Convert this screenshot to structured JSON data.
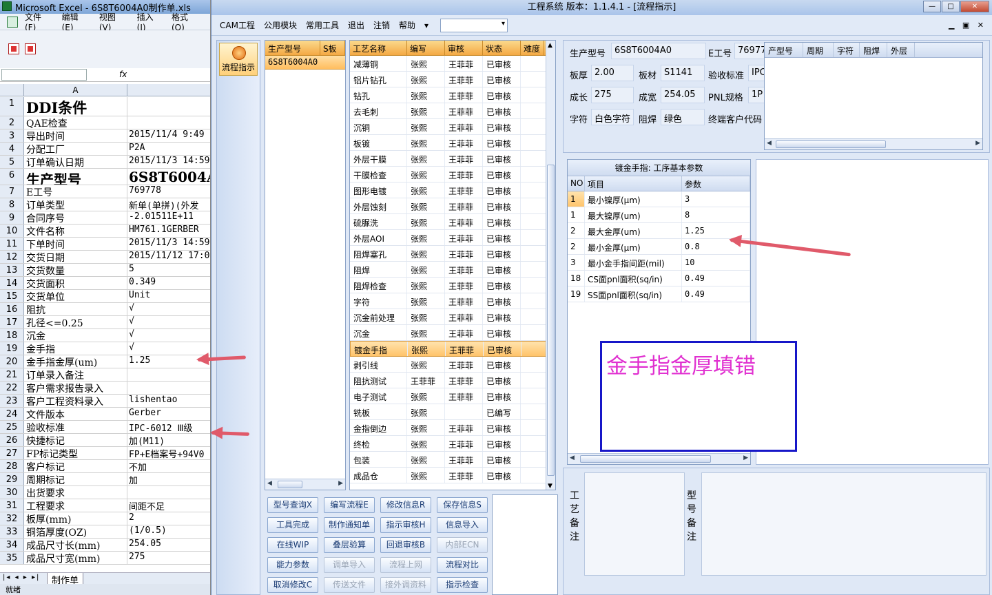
{
  "excel": {
    "title": "Microsoft Excel - 6S8T6004A0制作单.xls",
    "menu": [
      "文件(F)",
      "编辑(E)",
      "视图(V)",
      "插入(I)",
      "格式(O)"
    ],
    "fx": "fx",
    "col_header": "A",
    "rows": [
      {
        "n": "1",
        "a": "DDI条件",
        "b": "",
        "style": "big"
      },
      {
        "n": "2",
        "a": "QAE检查",
        "b": ""
      },
      {
        "n": "3",
        "a": "导出时间",
        "b": "2015/11/4 9:49"
      },
      {
        "n": "4",
        "a": "分配工厂",
        "b": "P2A"
      },
      {
        "n": "5",
        "a": "订单确认日期",
        "b": "2015/11/3 14:59"
      },
      {
        "n": "6",
        "a": "生产型号",
        "b": "6S8T6004A0",
        "style": "mid"
      },
      {
        "n": "7",
        "a": "E工号",
        "b": "769778"
      },
      {
        "n": "8",
        "a": "订单类型",
        "b": "新单(单拼)(外发"
      },
      {
        "n": "9",
        "a": "合同序号",
        "b": "-2.01511E+11"
      },
      {
        "n": "10",
        "a": "文件名称",
        "b": "HM761.1GERBER"
      },
      {
        "n": "11",
        "a": "下单时间",
        "b": "2015/11/3 14:59"
      },
      {
        "n": "12",
        "a": "交货日期",
        "b": "2015/11/12 17:0"
      },
      {
        "n": "13",
        "a": "交货数量",
        "b": "5"
      },
      {
        "n": "14",
        "a": "交货面积",
        "b": "0.349"
      },
      {
        "n": "15",
        "a": "交货单位",
        "b": "Unit"
      },
      {
        "n": "16",
        "a": "阻抗",
        "b": "√"
      },
      {
        "n": "17",
        "a": "孔径<=0.25",
        "b": "√"
      },
      {
        "n": "18",
        "a": "沉金",
        "b": "√"
      },
      {
        "n": "19",
        "a": "金手指",
        "b": "√"
      },
      {
        "n": "20",
        "a": "金手指金厚(um)",
        "b": "1.25"
      },
      {
        "n": "21",
        "a": "订单录入备注",
        "b": ""
      },
      {
        "n": "22",
        "a": "客户需求报告录入",
        "b": ""
      },
      {
        "n": "23",
        "a": "客户工程资料录入",
        "b": "lishentao"
      },
      {
        "n": "24",
        "a": "文件版本",
        "b": "Gerber"
      },
      {
        "n": "25",
        "a": "验收标准",
        "b": "IPC-6012 Ⅲ级"
      },
      {
        "n": "26",
        "a": "快捷标记",
        "b": "加(M11)"
      },
      {
        "n": "27",
        "a": "FP标记类型",
        "b": "FP+E档案号+94V0"
      },
      {
        "n": "28",
        "a": "客户标记",
        "b": "不加"
      },
      {
        "n": "29",
        "a": "周期标记",
        "b": "加"
      },
      {
        "n": "30",
        "a": "出货要求",
        "b": ""
      },
      {
        "n": "31",
        "a": "工程要求",
        "b": "间距不足"
      },
      {
        "n": "32",
        "a": "板厚(mm)",
        "b": "2"
      },
      {
        "n": "33",
        "a": "铜箔厚度(OZ)",
        "b": "(1/0.5)"
      },
      {
        "n": "34",
        "a": "成品尺寸长(mm)",
        "b": "254.05"
      },
      {
        "n": "35",
        "a": "成品尺寸宽(mm)",
        "b": "275"
      }
    ],
    "sheet_nav": "|◂ ◂ ▸ ▸|",
    "sheet_tab": "制作单",
    "status": "就绪"
  },
  "app": {
    "title": "工程系统   版本：1.1.4.1 - [流程指示]",
    "window_buttons": [
      "—",
      "□",
      "✕"
    ],
    "menu": [
      "CAM工程",
      "公用模块",
      "常用工具",
      "退出",
      "注销",
      "帮助",
      "▾"
    ],
    "mdi_buttons": "▁ ▣ ✕",
    "nav_button": "流程指示",
    "model_list": {
      "headers": [
        "生产型号",
        "S板"
      ],
      "rows": [
        "6S8T6004A0"
      ]
    },
    "process": {
      "headers": [
        "工艺名称",
        "编写",
        "审核",
        "状态",
        "难度"
      ],
      "rows": [
        [
          "减薄铜",
          "张熙",
          "王菲菲",
          "已审核",
          ""
        ],
        [
          "铝片钻孔",
          "张熙",
          "王菲菲",
          "已审核",
          ""
        ],
        [
          "钻孔",
          "张熙",
          "王菲菲",
          "已审核",
          ""
        ],
        [
          "去毛刺",
          "张熙",
          "王菲菲",
          "已审核",
          ""
        ],
        [
          "沉铜",
          "张熙",
          "王菲菲",
          "已审核",
          ""
        ],
        [
          "板镀",
          "张熙",
          "王菲菲",
          "已审核",
          ""
        ],
        [
          "外层干膜",
          "张熙",
          "王菲菲",
          "已审核",
          ""
        ],
        [
          "干膜检查",
          "张熙",
          "王菲菲",
          "已审核",
          ""
        ],
        [
          "图形电镀",
          "张熙",
          "王菲菲",
          "已审核",
          ""
        ],
        [
          "外层蚀刻",
          "张熙",
          "王菲菲",
          "已审核",
          ""
        ],
        [
          "硫脲洗",
          "张熙",
          "王菲菲",
          "已审核",
          ""
        ],
        [
          "外层AOI",
          "张熙",
          "王菲菲",
          "已审核",
          ""
        ],
        [
          "阻焊塞孔",
          "张熙",
          "王菲菲",
          "已审核",
          ""
        ],
        [
          "阻焊",
          "张熙",
          "王菲菲",
          "已审核",
          ""
        ],
        [
          "阻焊检查",
          "张熙",
          "王菲菲",
          "已审核",
          ""
        ],
        [
          "字符",
          "张熙",
          "王菲菲",
          "已审核",
          ""
        ],
        [
          "沉金前处理",
          "张熙",
          "王菲菲",
          "已审核",
          ""
        ],
        [
          "沉金",
          "张熙",
          "王菲菲",
          "已审核",
          ""
        ],
        [
          "镀金手指",
          "张熙",
          "王菲菲",
          "已审核",
          ""
        ],
        [
          "剥引线",
          "张熙",
          "王菲菲",
          "已审核",
          ""
        ],
        [
          "阻抗测试",
          "王菲菲",
          "王菲菲",
          "已审核",
          ""
        ],
        [
          "电子测试",
          "张熙",
          "王菲菲",
          "已审核",
          ""
        ],
        [
          "铣板",
          "张熙",
          "",
          "已编写",
          ""
        ],
        [
          "金指倒边",
          "张熙",
          "王菲菲",
          "已审核",
          ""
        ],
        [
          "终检",
          "张熙",
          "王菲菲",
          "已审核",
          ""
        ],
        [
          "包装",
          "张熙",
          "王菲菲",
          "已审核",
          ""
        ],
        [
          "成品仓",
          "张熙",
          "王菲菲",
          "已审核",
          ""
        ]
      ],
      "selected_index": 18
    },
    "buttons": [
      [
        "型号查询X",
        "编写流程E",
        "修改信息R",
        "保存信息S"
      ],
      [
        "工具完成",
        "制作通知单",
        "指示审核H",
        "信息导入"
      ],
      [
        "在线WIP",
        "叠层验算",
        "回退审核B",
        "内部ECN"
      ],
      [
        "能力参数",
        "调单导入",
        "流程上网",
        "流程对比"
      ],
      [
        "取消修改C",
        "传送文件",
        "接外调资料",
        "指示检查"
      ]
    ],
    "disabled_buttons": [
      "内部ECN",
      "调单导入",
      "流程上网",
      "传送文件",
      "接外调资料"
    ],
    "info": {
      "model_label": "生产型号",
      "model_value": "6S8T6004A0",
      "e_label": "E工号",
      "e_value": "769778",
      "thick_label": "板厚",
      "thick_value": "2.00",
      "material_label": "板材",
      "material_value": "S1141",
      "accept_label": "验收标准",
      "accept_value": "IPC",
      "len_label": "成长",
      "len_value": "275",
      "wid_label": "成宽",
      "wid_value": "254.05",
      "pnl_label": "PNL规格",
      "pnl_value": "1P",
      "char_label": "字符",
      "char_value": "白色字符",
      "mask_label": "阻焊",
      "mask_value": "绿色",
      "endcust_label": "终端客户代码"
    },
    "cycle_headers": [
      "产型号",
      "周期",
      "字符",
      "阻焊",
      "外层"
    ],
    "params": {
      "caption": "镀金手指: 工序基本参数",
      "headers": [
        "NO",
        "项目",
        "参数"
      ],
      "rows": [
        [
          "1",
          "最小镍厚(μm)",
          "3"
        ],
        [
          "1",
          "最大镍厚(um)",
          "8"
        ],
        [
          "2",
          "最大金厚(um)",
          "1.25"
        ],
        [
          "2",
          "最小金厚(μm)",
          "0.8"
        ],
        [
          "3",
          "最小金手指间距(mil)",
          "10"
        ],
        [
          "18",
          "CS面pnl面积(sq/in)",
          "0.49"
        ],
        [
          "19",
          "SS面pnl面积(sq/in)",
          "0.49"
        ]
      ]
    },
    "annotation": "金手指金厚填错",
    "remarks": {
      "process_label": "工艺备注",
      "model_label": "型号备注"
    }
  },
  "colors": {
    "accent_orange": "#ffc46a",
    "annotation_border": "#1717c8",
    "annotation_text": "#e030d0",
    "arrow": "#e05a6a"
  }
}
